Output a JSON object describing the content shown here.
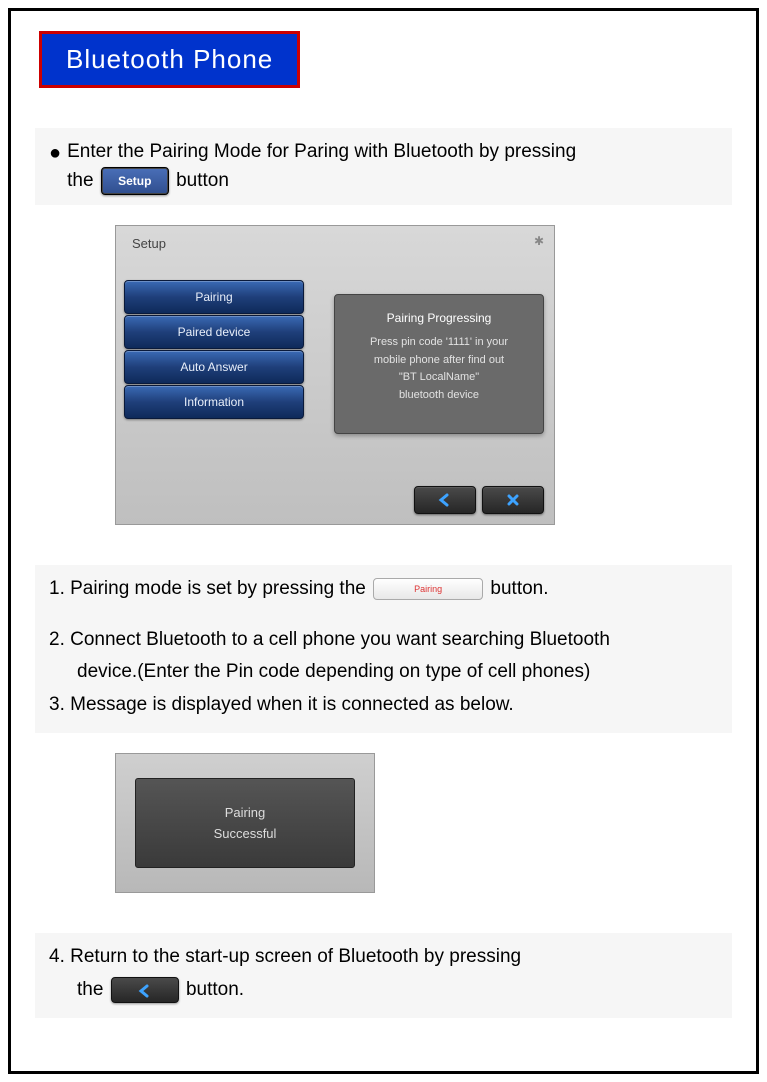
{
  "title": "Bluetooth Phone",
  "intro": {
    "line1_a": "Enter the Pairing Mode for Paring with Bluetooth by pressing",
    "line2_a": "the",
    "setup_btn": "Setup",
    "line2_b": "button"
  },
  "device1": {
    "header": "Setup",
    "menu": [
      "Pairing",
      "Paired device",
      "Auto Answer",
      "Information"
    ],
    "popup_title": "Pairing Progressing",
    "popup_body1": "Press pin code '1111' in your",
    "popup_body2": "mobile phone after find out",
    "popup_body3": "\"BT LocalName\"",
    "popup_body4": "bluetooth device"
  },
  "steps": {
    "s1_a": "1. Pairing mode is set by pressing the",
    "pairing_btn": "Pairing",
    "s1_b": "button.",
    "s2_a": "2. Connect Bluetooth to a cell phone you want searching Bluetooth",
    "s2_b": "device.(Enter the Pin code depending on type of cell phones)",
    "s3": "3. Message is displayed when it is connected as below."
  },
  "success": {
    "line1": "Pairing",
    "line2": "Successful"
  },
  "step4": {
    "a": "4. Return to the start-up screen of Bluetooth by pressing",
    "b_a": "the",
    "b_b": "button."
  }
}
